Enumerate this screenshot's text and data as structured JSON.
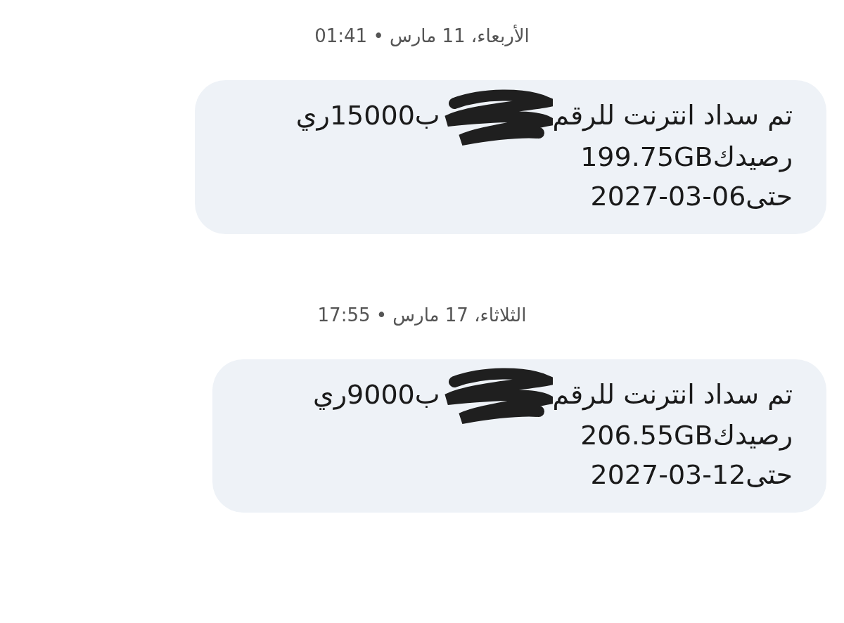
{
  "messages": [
    {
      "timestamp": "الأربعاء، 11 مارس • 01:41",
      "text_before_redaction": "تم سداد انترنت للرقم",
      "redacted": true,
      "text_after_redaction": "ب15000ري",
      "balance_line": "رصيدك199.75GB",
      "expiry_label": "حتى",
      "expiry_date": "2027-03-06"
    },
    {
      "timestamp": "الثلاثاء، 17 مارس • 17:55",
      "text_before_redaction": "تم سداد انترنت للرقم",
      "redacted": true,
      "text_after_redaction": "ب9000ري",
      "balance_line": "رصيدك206.55GB",
      "expiry_label": "حتى",
      "expiry_date": "2027-03-12"
    }
  ]
}
